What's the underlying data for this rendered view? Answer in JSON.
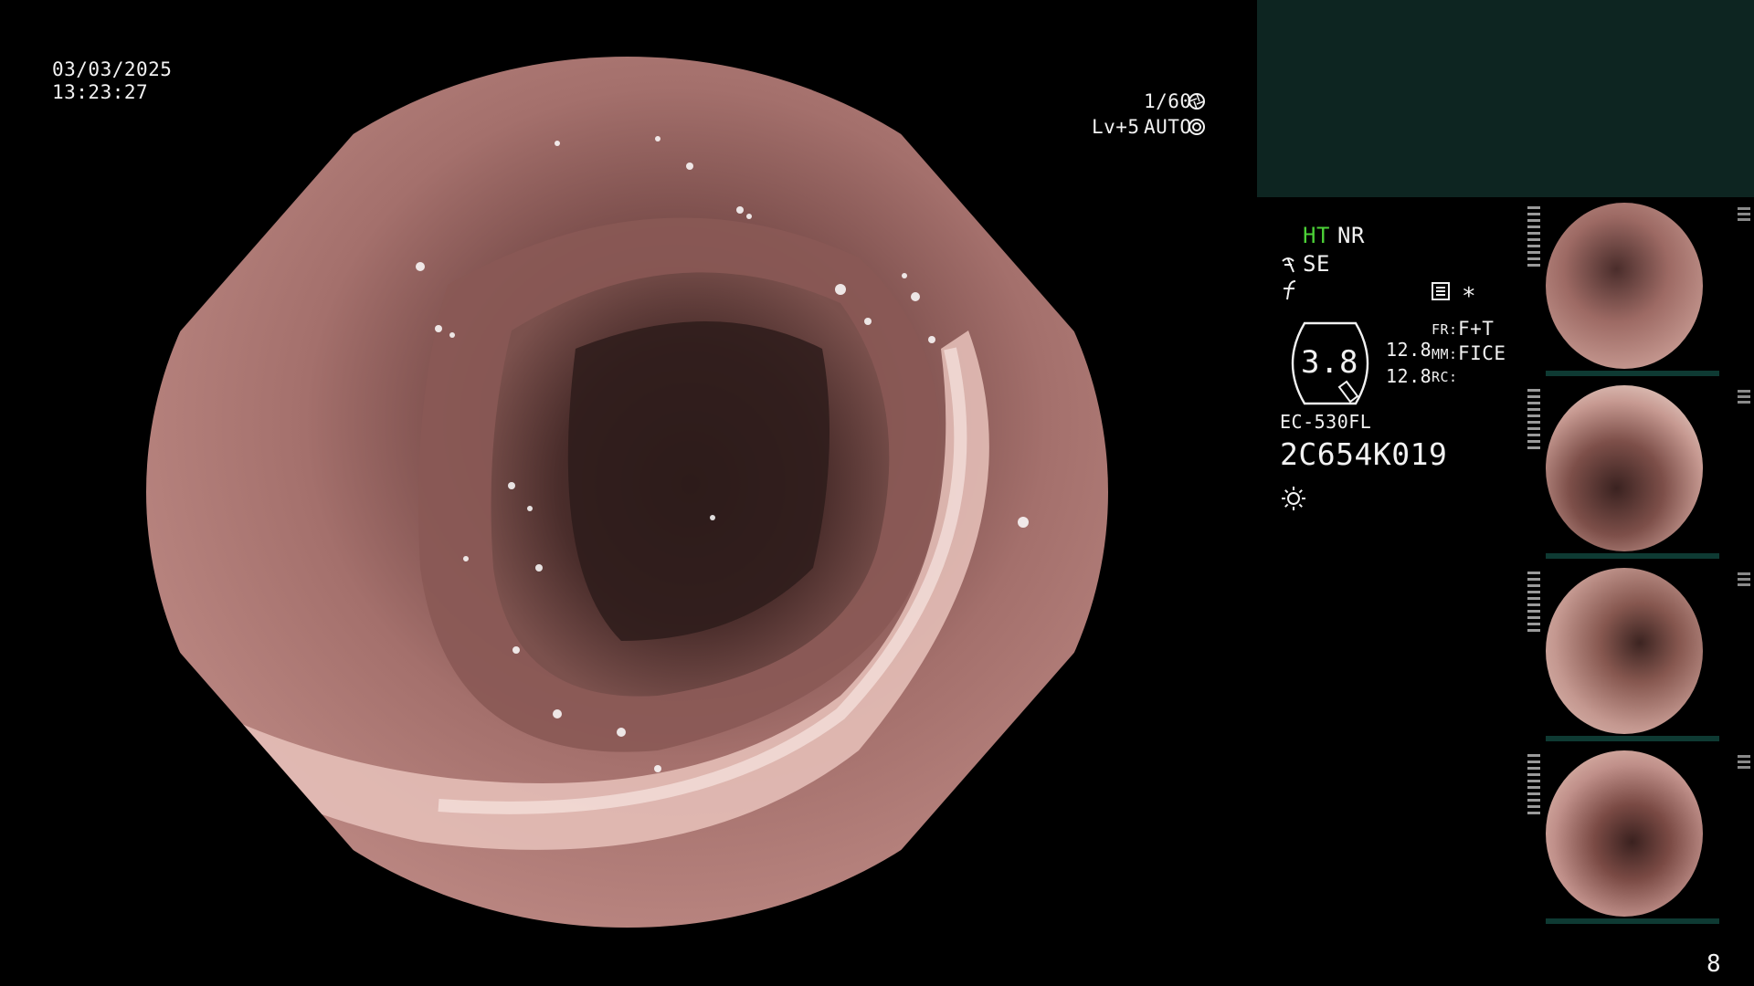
{
  "overlay": {
    "date": "03/03/2025",
    "time": "13:23:27",
    "shutter": "1/60",
    "shutter_icon": "aperture-icon",
    "exposure_level": "Lv+5",
    "exposure_mode": "AUTO",
    "exposure_icon": "iris-icon"
  },
  "status": {
    "ht": "HT",
    "nr": "NR",
    "se": "SE",
    "zoom": "3.8",
    "value_1": "12.8",
    "value_2": "12.8",
    "fr_label": "FR:",
    "fr_value": "F+T",
    "mm_label": "MM:",
    "mm_value": "FICE",
    "rc_label": "RC:",
    "asterisk": "*",
    "scope_model": "EC-530FL",
    "serial": "2C654K019",
    "ht_color": "#4cd137"
  },
  "thumbnails": {
    "count_badge": "8"
  },
  "colors": {
    "panel": "#0d2521",
    "mucosa": "#b0716c",
    "lumen": "#3a2221"
  }
}
